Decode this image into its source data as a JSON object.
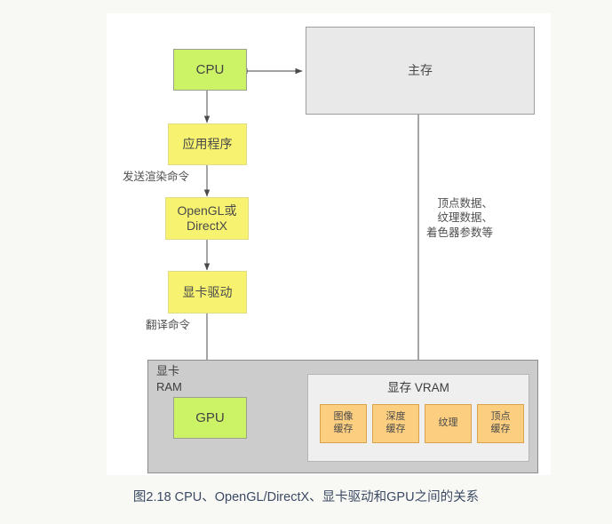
{
  "figure": {
    "caption": "图2.18 CPU、OpenGL/DirectX、显卡驱动和GPU之间的关系"
  },
  "colors": {
    "page_background": "#f8f8f5",
    "canvas_background": "#ffffff",
    "green_node": "#ccf266",
    "yellow_node": "#f7f371",
    "orange_node": "#fbce80",
    "gray_memory": "#e9e9e9",
    "card_container": "#cccccc",
    "vram_container": "#efefef",
    "connector": "#6b6b6b",
    "caption_text": "#3b4a63"
  },
  "nodes": {
    "cpu": "CPU",
    "main_memory": "主存",
    "application": "应用程序",
    "graphics_api": "OpenGL或\nDirectX",
    "display_driver": "显卡驱动",
    "gpu": "GPU"
  },
  "containers": {
    "graphics_card": "显卡\nRAM",
    "vram": "显存 VRAM"
  },
  "vram_buffers": [
    {
      "label": "图像\n缓存"
    },
    {
      "label": "深度\n缓存"
    },
    {
      "label": "纹理"
    },
    {
      "label": "顶点\n缓存"
    }
  ],
  "edge_labels": {
    "send_render_command": "发送渲染命令",
    "translate_command": "翻译命令",
    "memory_transfer": "顶点数据、\n纹理数据、\n着色器参数等"
  }
}
